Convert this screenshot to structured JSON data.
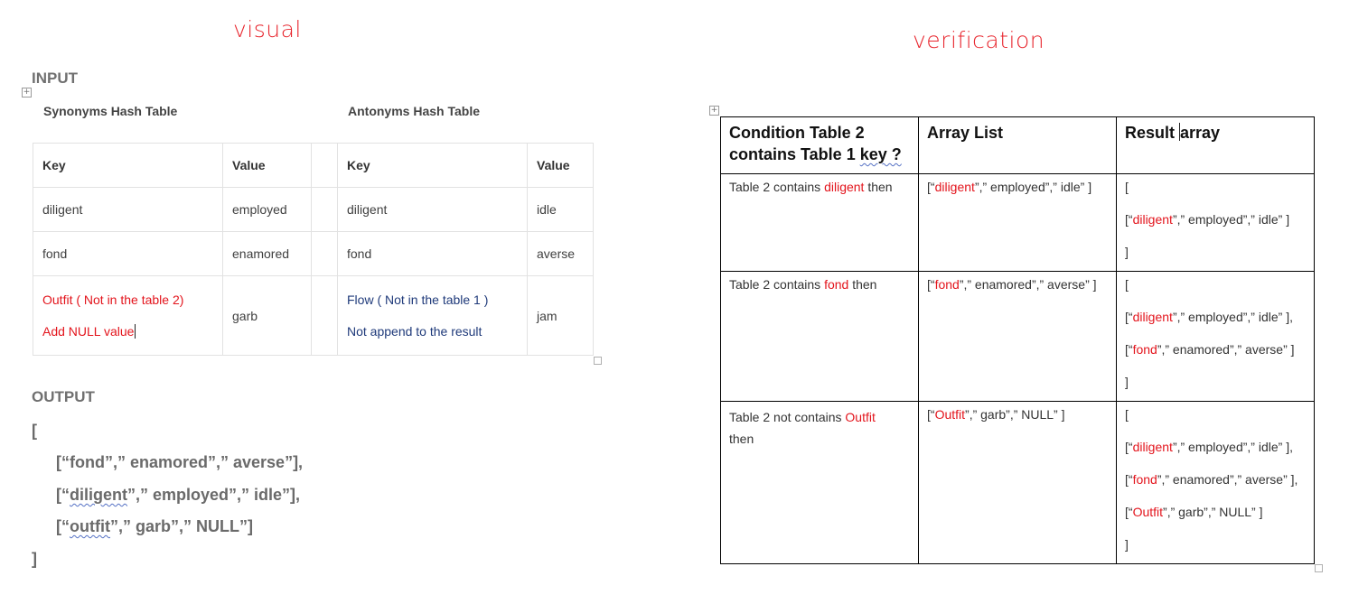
{
  "titles": {
    "visual": "visual",
    "verification": "verification"
  },
  "input_heading": "INPUT",
  "synonyms_caption": "Synonyms Hash Table",
  "antonyms_caption": "Antonyms Hash Table",
  "left_table": {
    "headers": [
      "Key",
      "Value",
      "Key",
      "Value"
    ],
    "rows": [
      {
        "syn_key": "diligent",
        "syn_value": "employed",
        "ant_key": "diligent",
        "ant_value": "idle"
      },
      {
        "syn_key": "fond",
        "syn_value": "enamored",
        "ant_key": "fond",
        "ant_value": "averse"
      }
    ],
    "last_row": {
      "syn_key_line1": "Outfit ( Not in the table 2)",
      "syn_key_line2": "Add NULL value",
      "syn_value": "garb",
      "ant_key_line1": "Flow ( Not in the table 1 )",
      "ant_key_line2": "Not append to the result",
      "ant_value": "jam"
    }
  },
  "output_heading": "OUTPUT",
  "output": {
    "open": "[",
    "line1": "[“fond”,” enamored”,” averse”],",
    "line2_a": "[“",
    "line2_b": "diligent",
    "line2_c": "”,” employed”,” idle”],",
    "line3_a": "[“",
    "line3_b": "outfit",
    "line3_c": "”,” garb”,” NULL”]",
    "close": "]"
  },
  "right_table": {
    "headers": {
      "condition_l1": "Condition Table 2",
      "condition_l2a": "contains Table 1 ",
      "condition_l2b": "key ?",
      "array_list": "Array List",
      "result_a": "Result ",
      "result_b": "array"
    },
    "row1": {
      "cond_a": "Table 2 contains ",
      "cond_b": "diligent",
      "cond_c": " then",
      "array": {
        "a": "[“",
        "b": "diligent",
        "c": "”,” employed”,” idle” ]"
      },
      "result_open": "[",
      "result_l1": {
        "a": "[“",
        "b": "diligent",
        "c": "”,” employed”,” idle” ]"
      },
      "result_close": "]"
    },
    "row2": {
      "cond_a": "Table 2 contains ",
      "cond_b": "fond",
      "cond_c": " then",
      "array": {
        "a": "[“",
        "b": "fond",
        "c": "”,” enamored”,” averse” ]"
      },
      "result_open": "[",
      "result_l1": {
        "a": "[“",
        "b": "diligent",
        "c": "”,” employed”,” idle” ],"
      },
      "result_l2": {
        "a": "[“",
        "b": "fond",
        "c": "”,” enamored”,” averse” ]"
      },
      "result_close": "]"
    },
    "row3": {
      "cond_a": "Table 2 not contains ",
      "cond_b": "Outfit",
      "cond_c": "then",
      "array": {
        "a": "[“",
        "b": "Outfit",
        "c": "”,” garb”,” NULL” ]"
      },
      "result_open": "[",
      "result_l1": {
        "a": "[“",
        "b": "diligent",
        "c": "”,” employed”,” idle” ],"
      },
      "result_l2": {
        "a": "[“",
        "b": "fond",
        "c": "”,” enamored”,” averse” ],"
      },
      "result_l3": {
        "a": "[“",
        "b": "Outfit",
        "c": "”,” garb”,” NULL” ]"
      },
      "result_close": "]"
    }
  }
}
